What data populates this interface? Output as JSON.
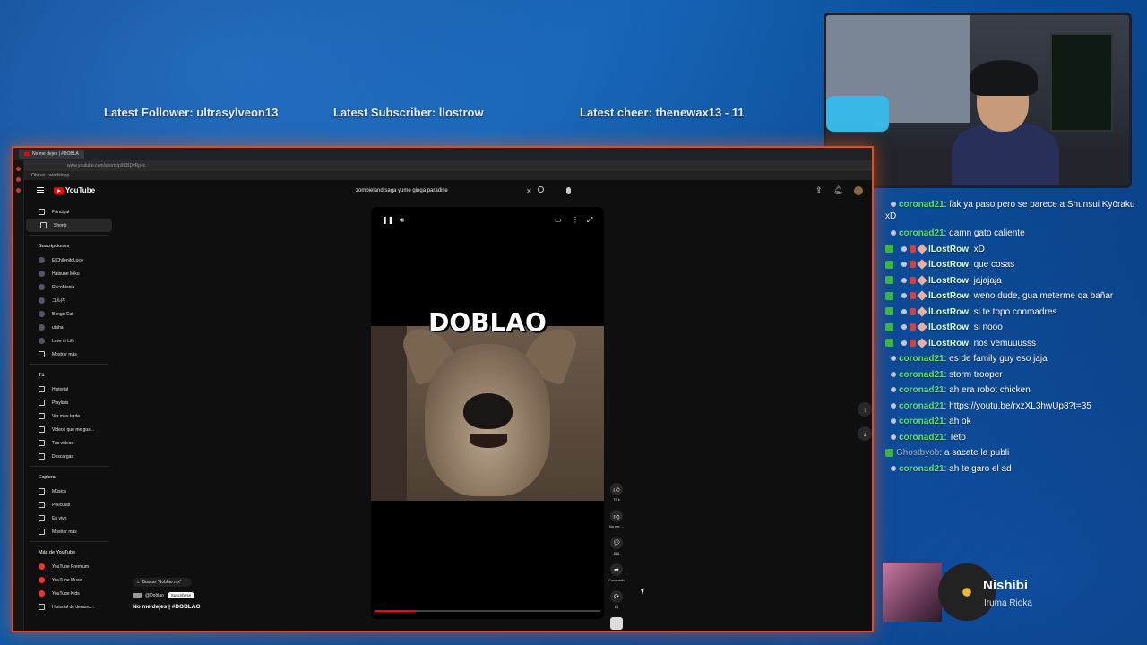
{
  "ticker": {
    "follower": "Latest Follower: ultrasylveon13",
    "subscriber": "Latest Subscriber: llostrow",
    "cheer": "Latest cheer: thenewax13 - 11"
  },
  "browser": {
    "tab_title": "No me dejes | #DOBLA",
    "address": "www.youtube.com/shorts/p9CBDvRp4c",
    "bookmark": "Obtrun - windstopp..."
  },
  "youtube": {
    "logo": "YouTube",
    "search_value": "zombieland saga yume ginga paradise",
    "sidebar": {
      "main": [
        "Principal",
        "Shorts"
      ],
      "subscriptions_header": "Suscripciones",
      "subscriptions": [
        "ElChilenitoLoco",
        "Hatsune Miku",
        "RucoMania",
        "ユル円",
        "Bongo Cat",
        "utaha",
        "Love is Life",
        "Mostrar más"
      ],
      "you_header": "Tú",
      "you": [
        "Historial",
        "Playlists",
        "Ver más tarde",
        "Videos que me gus...",
        "Tus videos",
        "Descargas"
      ],
      "explore_header": "Explorar",
      "explore": [
        "Música",
        "Películas",
        "En vivo",
        "Mostrar más"
      ],
      "more_header": "Más de YouTube",
      "more": [
        "YouTube Premium",
        "YouTube Music",
        "YouTube Kids",
        "Historial de denunc..."
      ]
    },
    "short": {
      "overlay_text": "DOBLAO",
      "progress": 0.18,
      "likes": "75 k",
      "dislike_label": "No me ...",
      "comments": "886",
      "share_label": "Compartir",
      "remix_count": "16"
    },
    "info": {
      "search_chip": "Buscar \"doblao mx\"",
      "channel": "@Doblao",
      "subscribe": "Suscribirse",
      "title": "No me dejes | #DOBLAO"
    }
  },
  "chat": [
    {
      "user": "coronad21",
      "type": "coronad",
      "badges": [
        "c"
      ],
      "text": "fak ya paso pero se parece a Shunsui Kyōraku xD",
      "wrap": true
    },
    {
      "user": "coronad21",
      "type": "coronad",
      "badges": [
        "c"
      ],
      "text": "damn gato caliente"
    },
    {
      "user": "lLostRow",
      "type": "lost",
      "badges": [
        "g",
        "c",
        "pin",
        "d"
      ],
      "text": "xD"
    },
    {
      "user": "lLostRow",
      "type": "lost",
      "badges": [
        "g",
        "c",
        "pin",
        "d"
      ],
      "text": "que cosas"
    },
    {
      "user": "lLostRow",
      "type": "lost",
      "badges": [
        "g",
        "c",
        "pin",
        "d"
      ],
      "text": "jajajaja"
    },
    {
      "user": "lLostRow",
      "type": "lost",
      "badges": [
        "g",
        "c",
        "pin",
        "d"
      ],
      "text": "weno dude, gua meterme qa bañar"
    },
    {
      "user": "lLostRow",
      "type": "lost",
      "badges": [
        "g",
        "c",
        "pin",
        "d"
      ],
      "text": "si te topo conmadres"
    },
    {
      "user": "lLostRow",
      "type": "lost",
      "badges": [
        "g",
        "c",
        "pin",
        "d"
      ],
      "text": "si nooo"
    },
    {
      "user": "lLostRow",
      "type": "lost",
      "badges": [
        "g",
        "c",
        "pin",
        "d"
      ],
      "text": "nos vemuuusss"
    },
    {
      "user": "coronad21",
      "type": "coronad",
      "badges": [
        "c"
      ],
      "text": "es de family guy eso jaja"
    },
    {
      "user": "coronad21",
      "type": "coronad",
      "badges": [
        "c"
      ],
      "text": "storm trooper"
    },
    {
      "user": "coronad21",
      "type": "coronad",
      "badges": [
        "c"
      ],
      "text": "ah era robot chicken"
    },
    {
      "user": "coronad21",
      "type": "coronad",
      "badges": [
        "c"
      ],
      "text": "https://youtu.be/rxzXL3hwUp8?t=35"
    },
    {
      "user": "coronad21",
      "type": "coronad",
      "badges": [
        "c"
      ],
      "text": "ah ok"
    },
    {
      "user": "coronad21",
      "type": "coronad",
      "badges": [
        "c"
      ],
      "text": "Teto"
    },
    {
      "user": "Ghostbyob",
      "type": "ghost",
      "badges": [
        "g"
      ],
      "text": "a sacate la publi"
    },
    {
      "user": "coronad21",
      "type": "coronad",
      "badges": [
        "c"
      ],
      "text": "ah te garo el ad"
    }
  ],
  "now_playing": {
    "title": "Nishibi",
    "artist": "Iruma Rioka"
  },
  "colors": {
    "accent_border": "#e84b1a",
    "youtube_red": "#ff0000",
    "chat_name_green": "#5ee06a"
  }
}
